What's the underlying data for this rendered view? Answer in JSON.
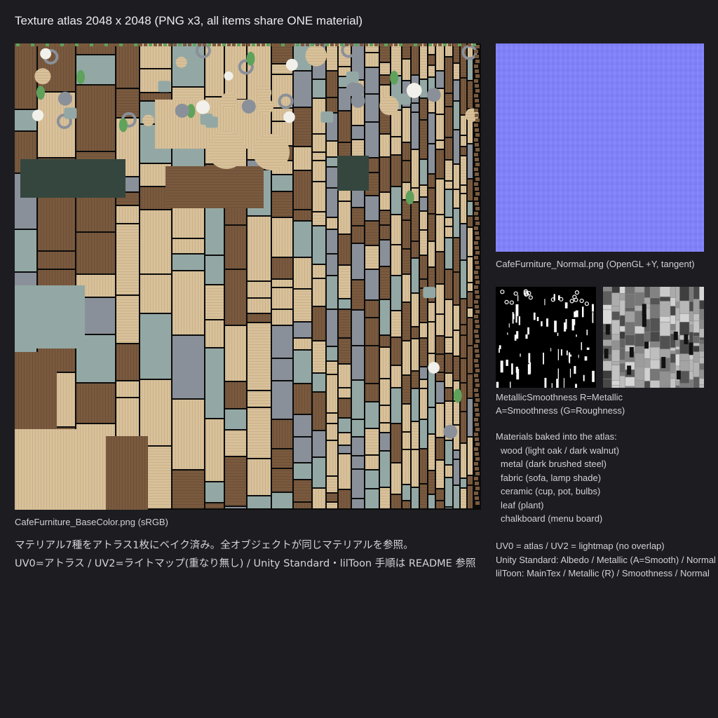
{
  "header": {
    "title": "Texture atlas 2048 x 2048 (PNG x3, all items share ONE material)"
  },
  "textures": {
    "base_color": {
      "caption": "CafeFurniture_BaseColor.png  (sRGB)"
    },
    "normal": {
      "caption": "CafeFurniture_Normal.png  (OpenGL +Y, tangent)",
      "color": "#8282fd"
    },
    "metallic_smoothness": {
      "caption_line1": "MetallicSmoothness  R=Metallic",
      "caption_line2": "A=Smoothness (G=Roughness)"
    }
  },
  "japanese_notes": {
    "line1": "マテリアル7種をアトラス1枚にベイク済み。全オブジェクトが同じマテリアルを参照。",
    "line2": "UV0=アトラス / UV2=ライトマップ(重なり無し) / Unity Standard・lilToon 手順は README 参照"
  },
  "materials": {
    "heading": "Materials baked into the atlas:",
    "items": [
      "wood (light oak / dark walnut)",
      "metal (dark brushed steel)",
      "fabric (sofa, lamp shade)",
      "ceramic (cup, pot, bulbs)",
      "leaf (plant)",
      "chalkboard (menu board)"
    ]
  },
  "uv_info": {
    "uv_line": "UV0 = atlas  /  UV2 = lightmap (no overlap)",
    "unity_standard": "Unity Standard: Albedo / Metallic (A=Smooth) / Normal",
    "liltoon": "lilToon: MainTex / Metallic (R) / Smoothness / Normal"
  },
  "palette": {
    "background": "#1c1c21",
    "light_oak": "#d8c19a",
    "dark_walnut": "#7a5a3e",
    "metal": "#8a9099",
    "fabric": "#93a8a4",
    "ceramic": "#f2f0ea",
    "leaf": "#5fa25c",
    "chalkboard": "#34463e"
  }
}
